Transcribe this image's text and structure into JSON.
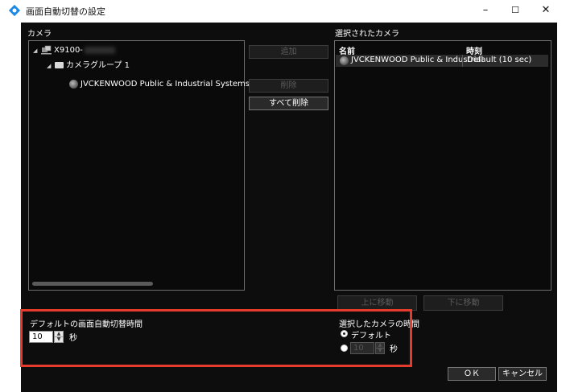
{
  "window": {
    "title": "画面自動切替の設定",
    "minimize": "–",
    "maximize": "☐",
    "close": "✕"
  },
  "camera_tree": {
    "label": "カメラ",
    "server": {
      "name": "X9100-"
    },
    "group": {
      "name": "カメラグループ 1"
    },
    "camera": {
      "name": "JVCKENWOOD Public & Industrial Systems Corp"
    }
  },
  "buttons": {
    "add": "追加",
    "remove": "削除",
    "remove_all": "すべて削除",
    "move_up": "上に移動",
    "move_down": "下に移動",
    "ok": "ＯＫ",
    "cancel": "キャンセル"
  },
  "selected": {
    "label": "選択されたカメラ",
    "col_name": "名前",
    "col_time": "時刻",
    "rows": [
      {
        "name": "JVCKENWOOD Public & Industrial",
        "time": "Default (10 sec)"
      }
    ]
  },
  "default_interval": {
    "label": "デフォルトの画面自動切替時間",
    "value": "10",
    "unit": "秒"
  },
  "camera_interval": {
    "label": "選択したカメラの時間",
    "default_option": "デフォルト",
    "value": "10",
    "unit": "秒"
  },
  "colors": {
    "highlight": "#e53b2c",
    "background": "#0d0d0d",
    "app_icon": "#1e88e5"
  },
  "icons": {
    "app": "gear-diamond-icon",
    "server": "server-icon",
    "folder": "folder-icon",
    "camera": "camera-icon"
  }
}
